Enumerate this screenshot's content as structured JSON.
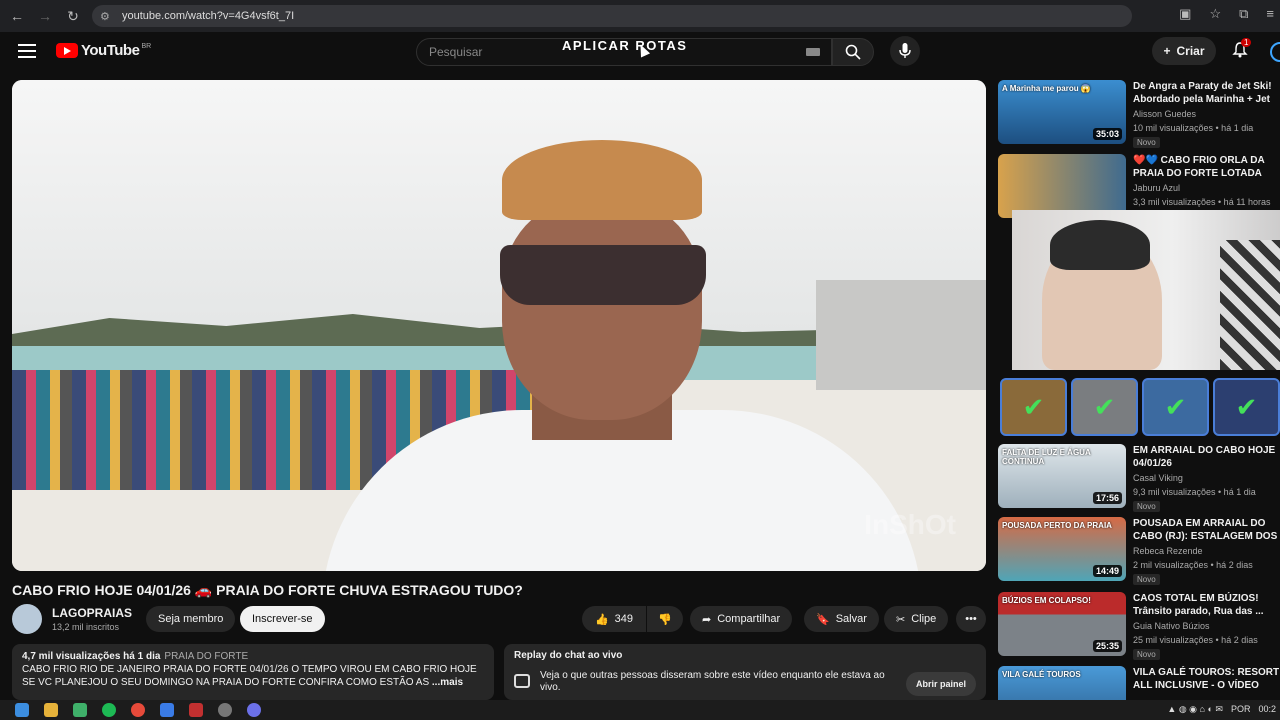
{
  "browser": {
    "url": "youtube.com/watch?v=4G4vsf6t_7I"
  },
  "header": {
    "logo_text": "YouTube",
    "logo_region": "BR",
    "search_placeholder": "Pesquisar",
    "overlay_text": "APLICAR ROTAS",
    "create_label": "Criar",
    "notifications_count": "1"
  },
  "video": {
    "title": "CABO FRIO HOJE 04/01/26 🚗 PRAIA DO FORTE CHUVA ESTRAGOU TUDO?",
    "watermark": "InShOt"
  },
  "channel": {
    "name": "LAGOPRAIAS",
    "subs": "13,2 mil inscritos",
    "member_label": "Seja membro",
    "subscribe_label": "Inscrever-se"
  },
  "actions": {
    "likes": "349",
    "share_label": "Compartilhar",
    "save_label": "Salvar",
    "clip_label": "Clipe"
  },
  "description": {
    "meta": "4,7 mil visualizações  há 1 dia",
    "tag": "PRAIA DO FORTE",
    "line1": "CABO FRIO RIO DE JANEIRO PRAIA DO FORTE 04/01/26 O TEMPO VIROU EM CABO FRIO HOJE",
    "line2": "SE VC PLANEJOU O SEU DOMINGO NA PRAIA DO FORTE CONFIRA COMO ESTÃO AS",
    "more": "...mais"
  },
  "chat": {
    "title": "Replay do chat ao vivo",
    "body": "Veja o que outras pessoas disseram sobre este vídeo enquanto ele estava ao vivo.",
    "button": "Abrir painel"
  },
  "recommendations": [
    {
      "thumb_label": "A Marinha me parou 😱",
      "duration": "35:03",
      "title": "De Angra a Paraty de Jet Ski! Abordado pela Marinha + Jet ...",
      "channel": "Alisson Guedes",
      "stats": "10 mil visualizações • há 1 dia",
      "badge": "Novo",
      "color": "#2c6fb0"
    },
    {
      "thumb_label": "",
      "duration": "",
      "title": "❤️💙 CABO FRIO ORLA DA PRAIA DO FORTE LOTADA",
      "channel": "Jaburu Azul",
      "stats": "3,3 mil visualizações • há 11 horas",
      "badge": "",
      "color": "#a88c5a"
    },
    {
      "thumb_label": "FALTA DE LUZ E ÁGUA CONTINUA",
      "duration": "17:56",
      "title": "EM ARRAIAL DO CABO HOJE 04/01/26",
      "channel": "Casal Viking",
      "stats": "9,3 mil visualizações • há 1 dia",
      "badge": "Novo",
      "color": "#8fa5b3"
    },
    {
      "thumb_label": "POUSADA PERTO DA PRAIA",
      "duration": "14:49",
      "title": "POUSADA EM ARRAIAL DO CABO (RJ): ESTALAGEM DOS ...",
      "channel": "Rebeca Rezende",
      "stats": "2 mil visualizações • há 2 dias",
      "badge": "Novo",
      "color": "#c2553a"
    },
    {
      "thumb_label": "BÚZIOS EM COLAPSO!",
      "duration": "25:35",
      "title": "CAOS TOTAL EM BÚZIOS! Trânsito parado, Rua das ...",
      "channel": "Guia Nativo Búzios",
      "stats": "25 mil visualizações • há 2 dias",
      "badge": "Novo",
      "color": "#6c7378"
    },
    {
      "thumb_label": "VILA GALÉ TOUROS",
      "duration": "",
      "title": "VILA GALÉ TOUROS: RESORT ALL INCLUSIVE - O VÍDEO MAI...",
      "channel": "",
      "stats": "",
      "badge": "",
      "color": "#3a86c2"
    }
  ],
  "taskbar": {
    "lang": "POR",
    "time": "00:2"
  }
}
